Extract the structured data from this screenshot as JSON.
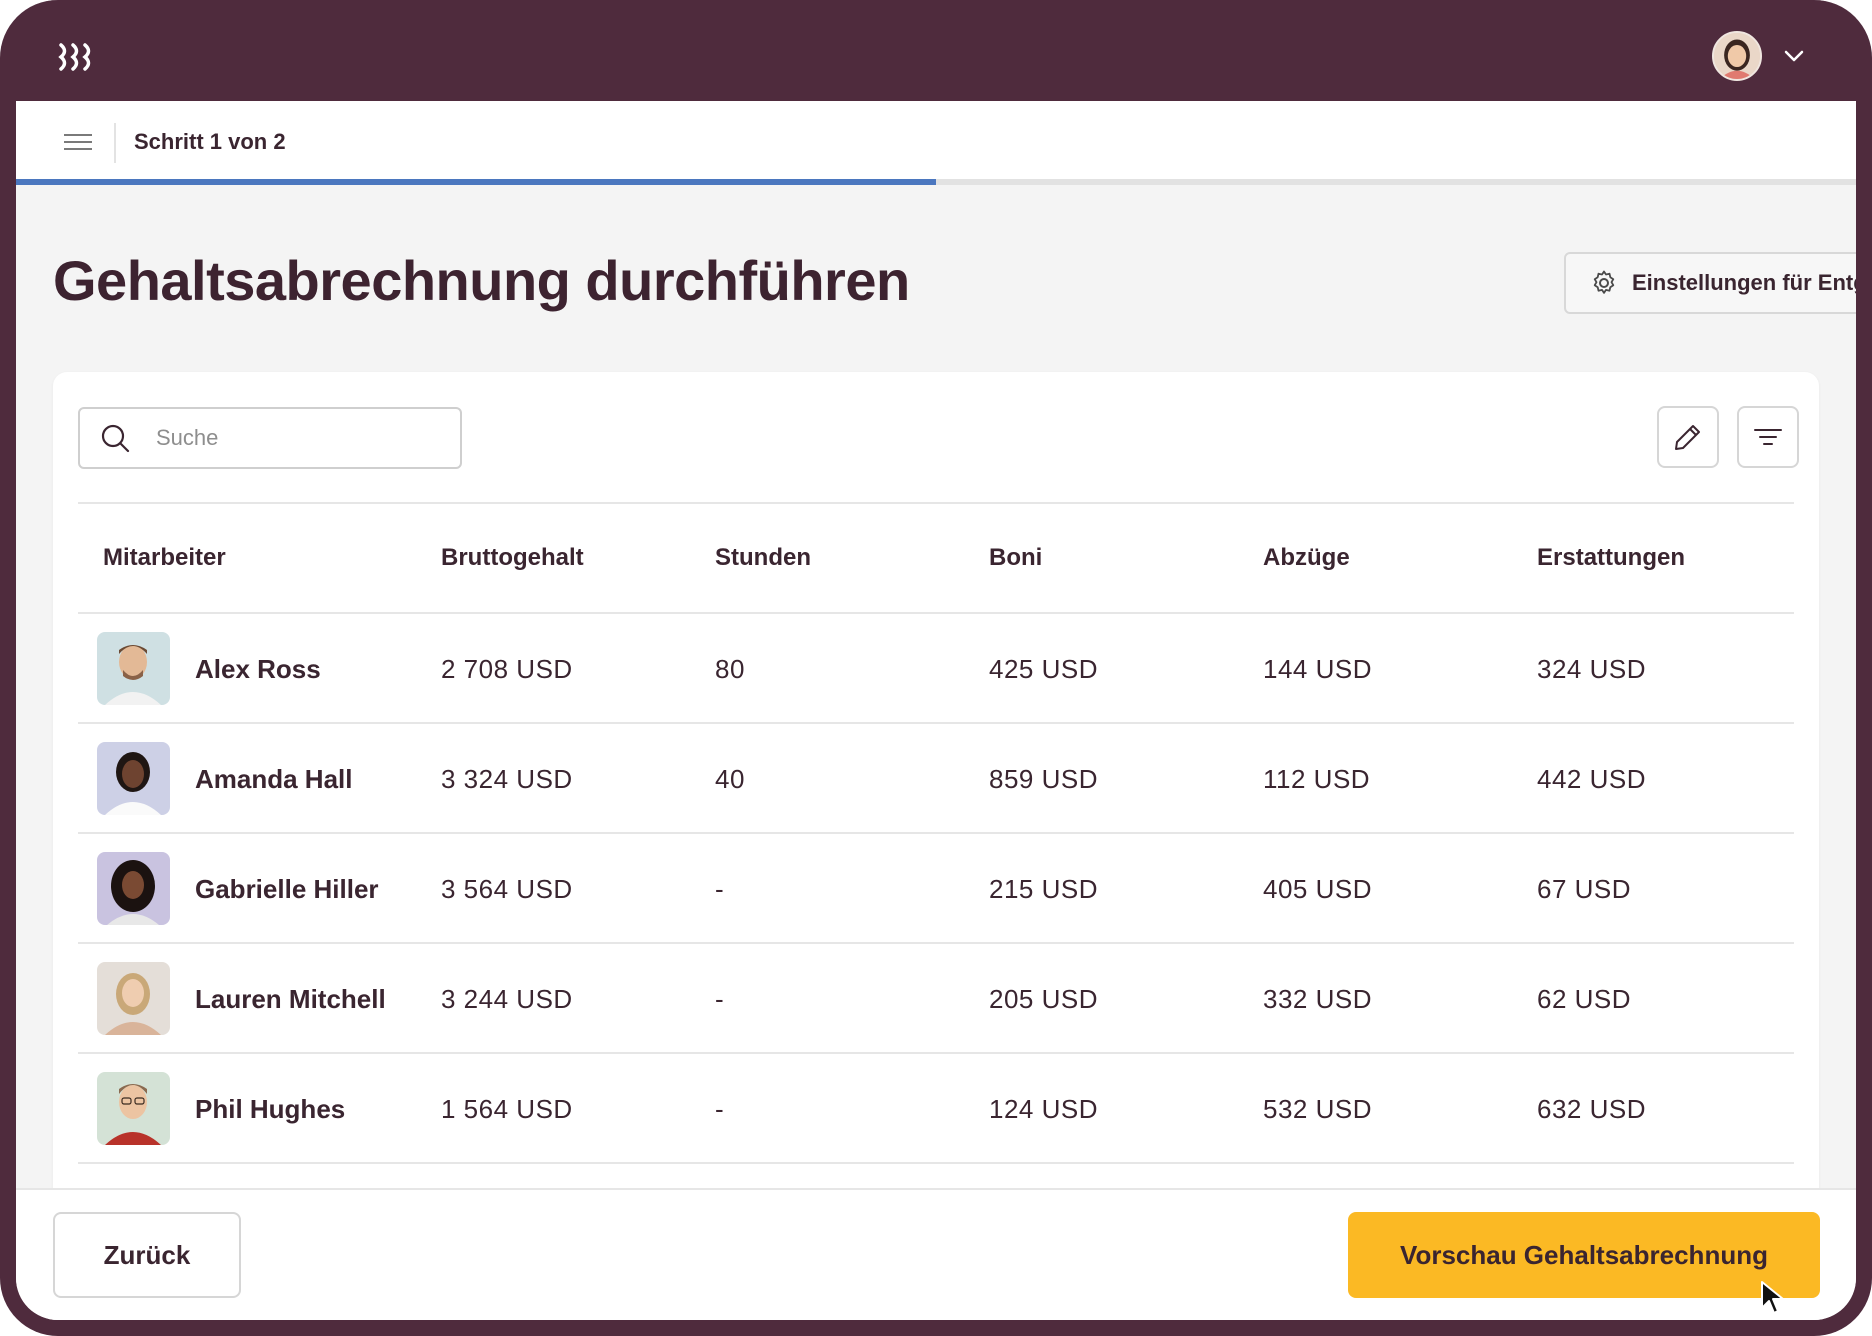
{
  "app": {
    "logo_icon": "brand-logo-icon",
    "header_bg": "#4f2b3d",
    "accent": "#fbb924",
    "progress_color": "#4b77bf"
  },
  "stepbar": {
    "label": "Schritt 1 von 2",
    "progress": 0.5
  },
  "page": {
    "title": "Gehaltsabrechnung durchführen",
    "settings_label": "Einstellungen für Entg"
  },
  "toolbar": {
    "search_placeholder": "Suche",
    "search_value": ""
  },
  "table": {
    "columns": [
      "Mitarbeiter",
      "Bruttogehalt",
      "Stunden",
      "Boni",
      "Abzüge",
      "Erstattungen"
    ],
    "rows": [
      {
        "name": "Alex Ross",
        "gross": "2 708 USD",
        "hours": "80",
        "bonus": "425 USD",
        "deductions": "144 USD",
        "reimbursements": "324 USD"
      },
      {
        "name": "Amanda Hall",
        "gross": "3 324 USD",
        "hours": "40",
        "bonus": "859 USD",
        "deductions": "112 USD",
        "reimbursements": "442 USD"
      },
      {
        "name": "Gabrielle Hiller",
        "gross": "3 564 USD",
        "hours": "-",
        "bonus": "215 USD",
        "deductions": "405 USD",
        "reimbursements": "67 USD"
      },
      {
        "name": "Lauren Mitchell",
        "gross": "3 244 USD",
        "hours": "-",
        "bonus": "205 USD",
        "deductions": "332 USD",
        "reimbursements": "62 USD"
      },
      {
        "name": "Phil Hughes",
        "gross": "1 564 USD",
        "hours": "-",
        "bonus": "124 USD",
        "deductions": "532 USD",
        "reimbursements": "632 USD"
      }
    ]
  },
  "footer": {
    "back_label": "Zurück",
    "preview_label": "Vorschau Gehaltsabrechnung"
  }
}
